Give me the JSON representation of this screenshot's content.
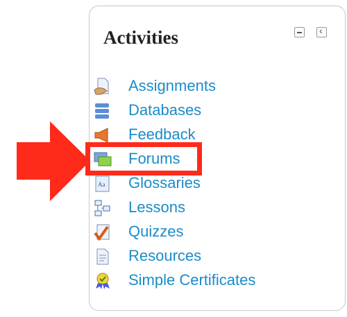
{
  "block": {
    "title": "Activities",
    "controls": {
      "minimize_icon": "minimize-icon",
      "dock_icon": "dock-icon"
    },
    "items": [
      {
        "label": "Assignments",
        "icon": "assignment-icon"
      },
      {
        "label": "Databases",
        "icon": "database-icon"
      },
      {
        "label": "Feedback",
        "icon": "feedback-icon"
      },
      {
        "label": "Forums",
        "icon": "forum-icon"
      },
      {
        "label": "Glossaries",
        "icon": "glossary-icon"
      },
      {
        "label": "Lessons",
        "icon": "lesson-icon"
      },
      {
        "label": "Quizzes",
        "icon": "quiz-icon"
      },
      {
        "label": "Resources",
        "icon": "resource-icon"
      },
      {
        "label": "Simple Certificates",
        "icon": "certificate-icon"
      }
    ]
  },
  "annotation": {
    "highlight_color": "#ff2a1a",
    "arrow_color": "#ff2a1a"
  },
  "link_color": "#1a8cc9"
}
